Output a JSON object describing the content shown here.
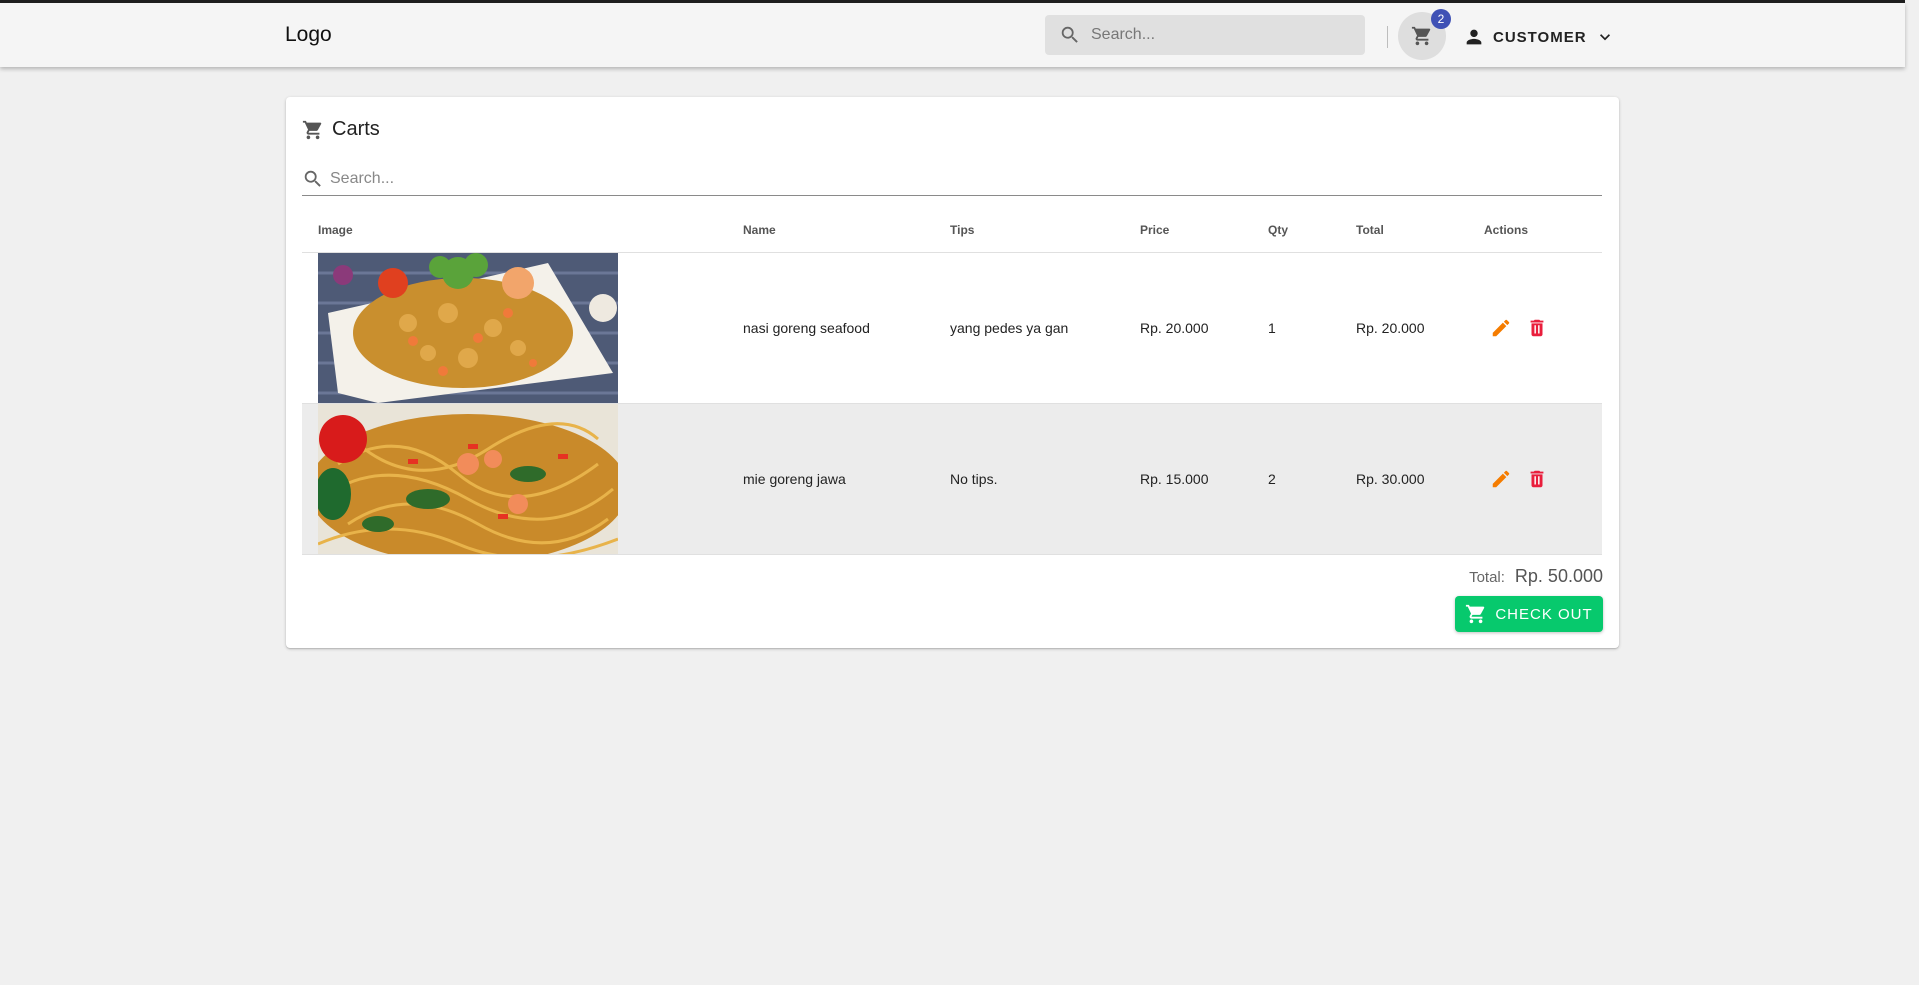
{
  "app": {
    "logo_text": "Logo",
    "search_placeholder": "Search...",
    "cart_count": "2",
    "user_label": "CUSTOMER"
  },
  "cart": {
    "title": "Carts",
    "search_placeholder": "Search...",
    "columns": [
      "Image",
      "Name",
      "Tips",
      "Price",
      "Qty",
      "Total",
      "Actions"
    ],
    "rows": [
      {
        "name": "nasi goreng seafood",
        "tips": "yang pedes ya gan",
        "price": "Rp. 20.000",
        "qty": "1",
        "total": "Rp. 20.000"
      },
      {
        "name": "mie goreng jawa",
        "tips": "No tips.",
        "price": "Rp. 15.000",
        "qty": "2",
        "total": "Rp. 30.000"
      }
    ],
    "total_label": "Total:",
    "total_value": "Rp. 50.000",
    "checkout_label": "CHECK OUT"
  },
  "colors": {
    "edit_icon": "#f57c00",
    "delete_icon": "#e91e3c",
    "checkout": "#07c96d",
    "badge": "#3f51b5"
  }
}
